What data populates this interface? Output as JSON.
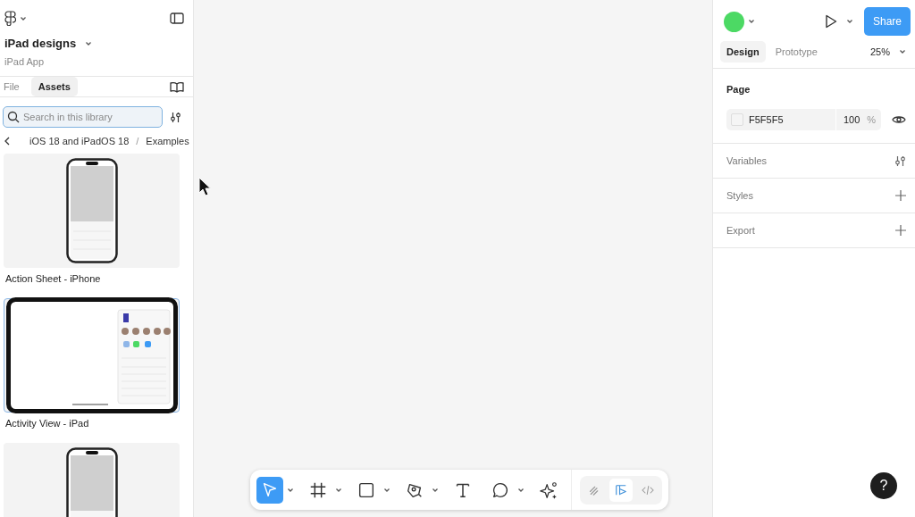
{
  "file": {
    "name": "iPad designs",
    "subtitle": "iPad App"
  },
  "left_tabs": [
    {
      "label": "File",
      "selected": false
    },
    {
      "label": "Assets",
      "selected": true
    }
  ],
  "search": {
    "placeholder": "Search in this library"
  },
  "breadcrumb": {
    "items": [
      "iOS 18 and iPadOS 18",
      "Examples"
    ],
    "separator": "/"
  },
  "assets": [
    {
      "name": "Action Sheet - iPhone",
      "kind": "iphone",
      "selected": false
    },
    {
      "name": "Activity View - iPad",
      "kind": "ipad",
      "selected": true
    },
    {
      "kind": "iphone",
      "selected": false
    }
  ],
  "share": "Share",
  "mode_tabs": [
    {
      "label": "Design",
      "selected": true
    },
    {
      "label": "Prototype",
      "selected": false
    }
  ],
  "zoom": "25%",
  "page": {
    "title": "Page",
    "color": "F5F5F5",
    "opacity": "100",
    "unit": "%"
  },
  "sections": [
    {
      "label": "Variables",
      "kind": "variables"
    },
    {
      "label": "Styles",
      "kind": "add"
    },
    {
      "label": "Export",
      "kind": "add"
    }
  ],
  "tools": [
    {
      "kind": "move",
      "selected": true,
      "dropdown": true
    },
    {
      "kind": "frame",
      "selected": false,
      "dropdown": true
    },
    {
      "kind": "rectangle",
      "selected": false,
      "dropdown": true
    },
    {
      "kind": "pen",
      "selected": false,
      "dropdown": true
    },
    {
      "kind": "text",
      "selected": false,
      "dropdown": false
    },
    {
      "kind": "comment",
      "selected": false,
      "dropdown": true
    },
    {
      "kind": "ai",
      "selected": false,
      "dropdown": false
    }
  ],
  "modes": [
    {
      "kind": "draw",
      "selected": false
    },
    {
      "kind": "design",
      "selected": true
    },
    {
      "kind": "dev",
      "selected": false
    }
  ],
  "help": "?"
}
